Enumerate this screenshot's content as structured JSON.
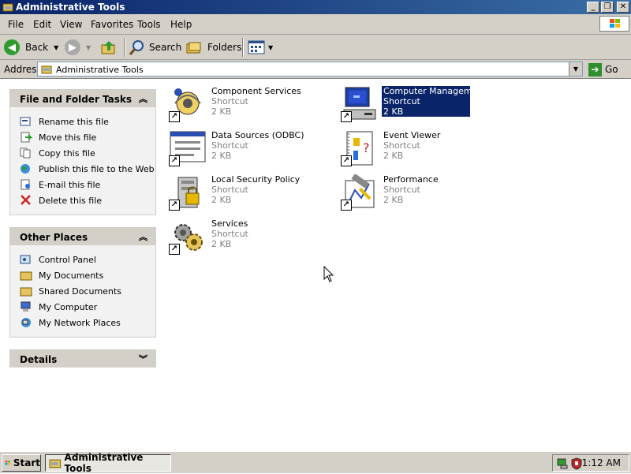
{
  "window": {
    "title": "Administrative Tools"
  },
  "menu": [
    "File",
    "Edit",
    "View",
    "Favorites",
    "Tools",
    "Help"
  ],
  "toolbar": {
    "back": "Back",
    "search": "Search",
    "folders": "Folders"
  },
  "address": {
    "label": "Address",
    "value": "Administrative Tools",
    "go": "Go"
  },
  "panels": {
    "tasks": {
      "title": "File and Folder Tasks",
      "items": [
        "Rename this file",
        "Move this file",
        "Copy this file",
        "Publish this file to the Web",
        "E-mail this file",
        "Delete this file"
      ]
    },
    "places": {
      "title": "Other Places",
      "items": [
        "Control Panel",
        "My Documents",
        "Shared Documents",
        "My Computer",
        "My Network Places"
      ]
    },
    "details": {
      "title": "Details"
    }
  },
  "files": [
    {
      "name": "Component Services",
      "type": "Shortcut",
      "size": "2 KB"
    },
    {
      "name": "Computer Management",
      "type": "Shortcut",
      "size": "2 KB",
      "selected": true
    },
    {
      "name": "Data Sources (ODBC)",
      "type": "Shortcut",
      "size": "2 KB"
    },
    {
      "name": "Event Viewer",
      "type": "Shortcut",
      "size": "2 KB"
    },
    {
      "name": "Local Security Policy",
      "type": "Shortcut",
      "size": "2 KB"
    },
    {
      "name": "Performance",
      "type": "Shortcut",
      "size": "2 KB"
    },
    {
      "name": "Services",
      "type": "Shortcut",
      "size": "2 KB"
    }
  ],
  "taskbar": {
    "start": "Start",
    "task": "Administrative Tools",
    "clock": "1:12 AM"
  },
  "colors": {
    "titlebar": "#0a246a",
    "selection": "#0a246a",
    "face": "#d4d0c8"
  }
}
